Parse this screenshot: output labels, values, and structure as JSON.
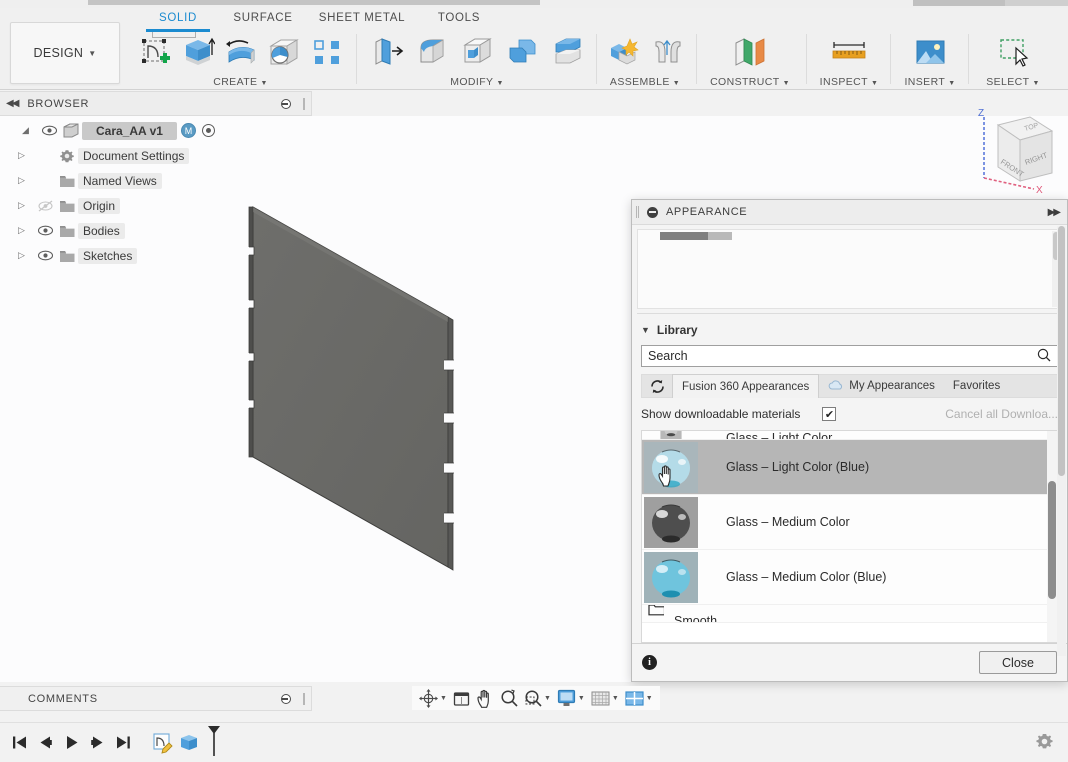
{
  "app": {
    "workspace_button": "DESIGN",
    "tabs": [
      {
        "label": "SOLID",
        "active": true
      },
      {
        "label": "SURFACE",
        "active": false
      },
      {
        "label": "SHEET METAL",
        "active": false
      },
      {
        "label": "TOOLS",
        "active": false
      }
    ],
    "accent_color": "#1b8bd0"
  },
  "ribbon": {
    "groups": [
      {
        "label": "CREATE",
        "icons": [
          "create-sketch-icon",
          "extrude-icon",
          "revolve-icon",
          "sphere-icon",
          "pattern-icon"
        ]
      },
      {
        "label": "MODIFY",
        "icons": [
          "press-pull-icon",
          "fillet-icon",
          "shell-icon",
          "combine-icon",
          "offset-face-icon"
        ]
      },
      {
        "label": "ASSEMBLE",
        "icons": [
          "new-component-icon",
          "joint-icon"
        ]
      },
      {
        "label": "CONSTRUCT",
        "icons": [
          "offset-plane-icon"
        ]
      },
      {
        "label": "INSPECT",
        "icons": [
          "measure-icon"
        ]
      },
      {
        "label": "INSERT",
        "icons": [
          "insert-image-icon"
        ]
      },
      {
        "label": "SELECT",
        "icons": [
          "window-selection-icon"
        ]
      }
    ]
  },
  "browser": {
    "title": "BROWSER",
    "items": [
      {
        "label": "Cara_AA v1",
        "level": 0,
        "icon": "component-icon",
        "eye": true,
        "badge": "M",
        "root": true
      },
      {
        "label": "Document Settings",
        "level": 1,
        "icon": "gear-icon",
        "eye": false
      },
      {
        "label": "Named Views",
        "level": 1,
        "icon": "folder-icon",
        "eye": false
      },
      {
        "label": "Origin",
        "level": 1,
        "icon": "folder-icon",
        "eye": true,
        "hidden": true
      },
      {
        "label": "Bodies",
        "level": 1,
        "icon": "folder-icon",
        "eye": true
      },
      {
        "label": "Sketches",
        "level": 1,
        "icon": "folder-icon",
        "eye": true
      }
    ]
  },
  "viewcube": {
    "faces": [
      "TOP",
      "FRONT",
      "RIGHT"
    ],
    "axes": [
      "Z",
      "X"
    ],
    "z_color": "#4f6fd4",
    "x_color": "#e05a7a"
  },
  "appearance": {
    "title": "APPEARANCE",
    "expand_icon": "expand-right-icon",
    "minimize_icon": "minimize-icon",
    "library": {
      "section_label": "Library",
      "search_value": "Search",
      "search_placeholder": "Search",
      "search_icon": "search-icon",
      "refresh_icon": "refresh-icon",
      "tabs": [
        {
          "label": "Fusion 360 Appearances",
          "selected": true,
          "icon": null
        },
        {
          "label": "My Appearances",
          "selected": false,
          "icon": "cloud-icon"
        },
        {
          "label": "Favorites",
          "selected": false,
          "icon": null
        }
      ],
      "show_downloadable_label": "Show downloadable materials",
      "show_downloadable_checked": true,
      "checkbox_glyph": "✔",
      "cancel_downloads_label": "Cancel all Downloa..."
    },
    "materials": [
      {
        "name": "Glass – Light Color",
        "selected": false,
        "partial": true,
        "thumb": "glass-clear"
      },
      {
        "name": "Glass – Light Color (Blue)",
        "selected": true,
        "partial": false,
        "thumb": "glass-light-blue"
      },
      {
        "name": "Glass – Medium Color",
        "selected": false,
        "partial": false,
        "thumb": "glass-dark"
      },
      {
        "name": "Glass – Medium Color (Blue)",
        "selected": false,
        "partial": false,
        "thumb": "glass-medium-blue"
      },
      {
        "name": "Smooth",
        "selected": false,
        "partial": true,
        "thumb": "folder-small"
      }
    ],
    "footer": {
      "info_icon": "info-icon",
      "info_glyph": "i",
      "close_label": "Close"
    },
    "cursor": "hand-cursor"
  },
  "comments": {
    "title": "COMMENTS"
  },
  "navbar": {
    "items": [
      {
        "name": "orbit-icon",
        "caret": true
      },
      {
        "name": "look-at-icon",
        "caret": false
      },
      {
        "name": "pan-icon",
        "caret": false
      },
      {
        "name": "zoom-icon",
        "caret": false
      },
      {
        "name": "zoom-window-icon",
        "caret": true
      },
      {
        "name": "display-settings-icon",
        "caret": true
      },
      {
        "name": "grid-snap-icon",
        "caret": true
      },
      {
        "name": "viewports-icon",
        "caret": true
      }
    ]
  },
  "timeline": {
    "controls": [
      {
        "name": "go-to-beginning-icon",
        "glyph": "⏮"
      },
      {
        "name": "step-back-icon",
        "glyph": "◀"
      },
      {
        "name": "play-icon",
        "glyph": "▶"
      },
      {
        "name": "step-forward-icon",
        "glyph": "▶"
      },
      {
        "name": "go-to-end-icon",
        "glyph": "⏭"
      }
    ],
    "features": [
      {
        "name": "sketch-feature-icon"
      },
      {
        "name": "extrude-feature-icon"
      }
    ],
    "settings_icon": "gear-icon"
  }
}
